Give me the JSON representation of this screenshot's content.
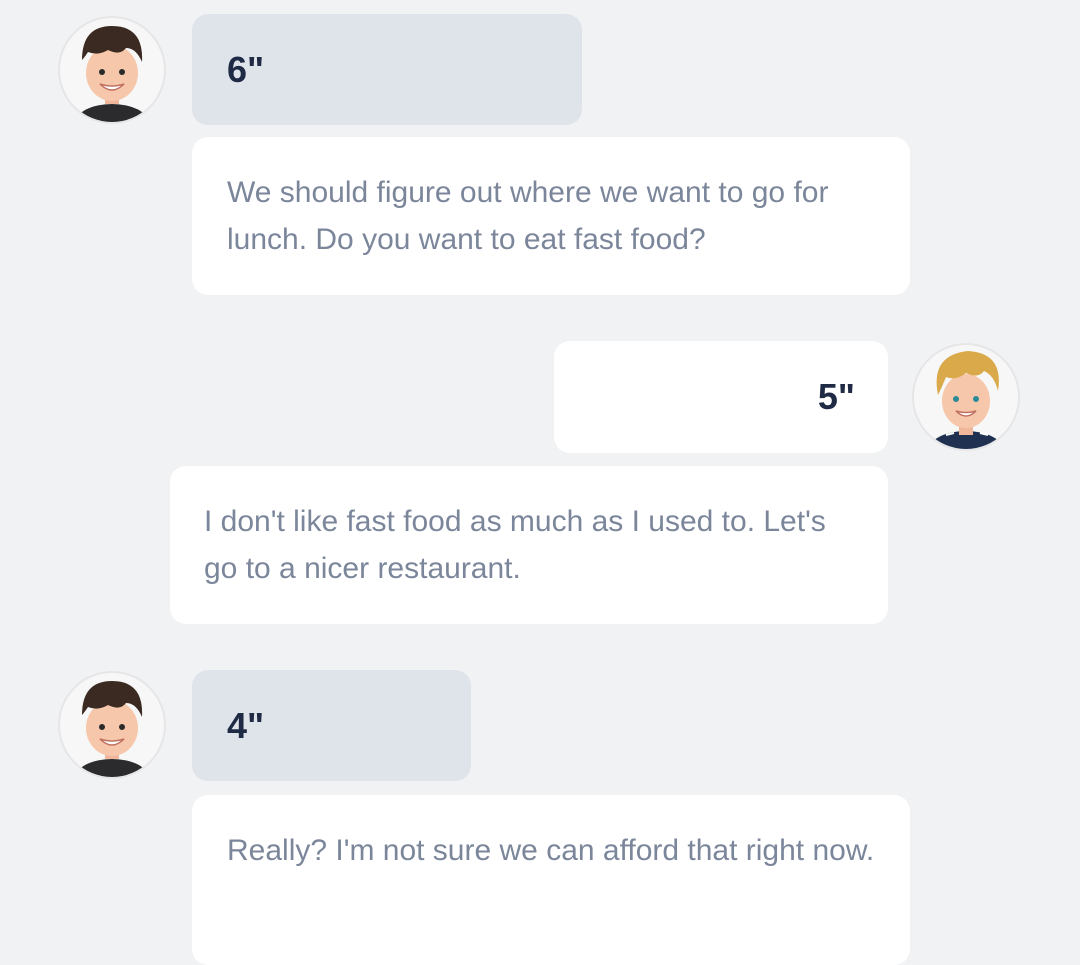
{
  "messages": [
    {
      "speaker": "speaker-a",
      "side": "left",
      "duration": "6\"",
      "text": "We should figure out where we want to go for lunch. Do you want to eat fast food?"
    },
    {
      "speaker": "speaker-b",
      "side": "right",
      "duration": "5\"",
      "text": "I don't like fast food as much as I used to. Let's go to a nicer restaurant."
    },
    {
      "speaker": "speaker-a",
      "side": "left",
      "duration": "4\"",
      "text": "Really? I'm not sure we can afford that right now."
    }
  ],
  "colors": {
    "background": "#f1f2f4",
    "left_audio_bubble": "#dfe3ea",
    "right_audio_bubble": "#ffffff",
    "text_bubble": "#ffffff",
    "duration_text": "#1f2a44",
    "message_text": "#7b869b"
  },
  "icons": {
    "speaker_a_avatar": "dark-haired-boy-avatar-icon",
    "speaker_b_avatar": "blonde-boy-avatar-icon"
  }
}
